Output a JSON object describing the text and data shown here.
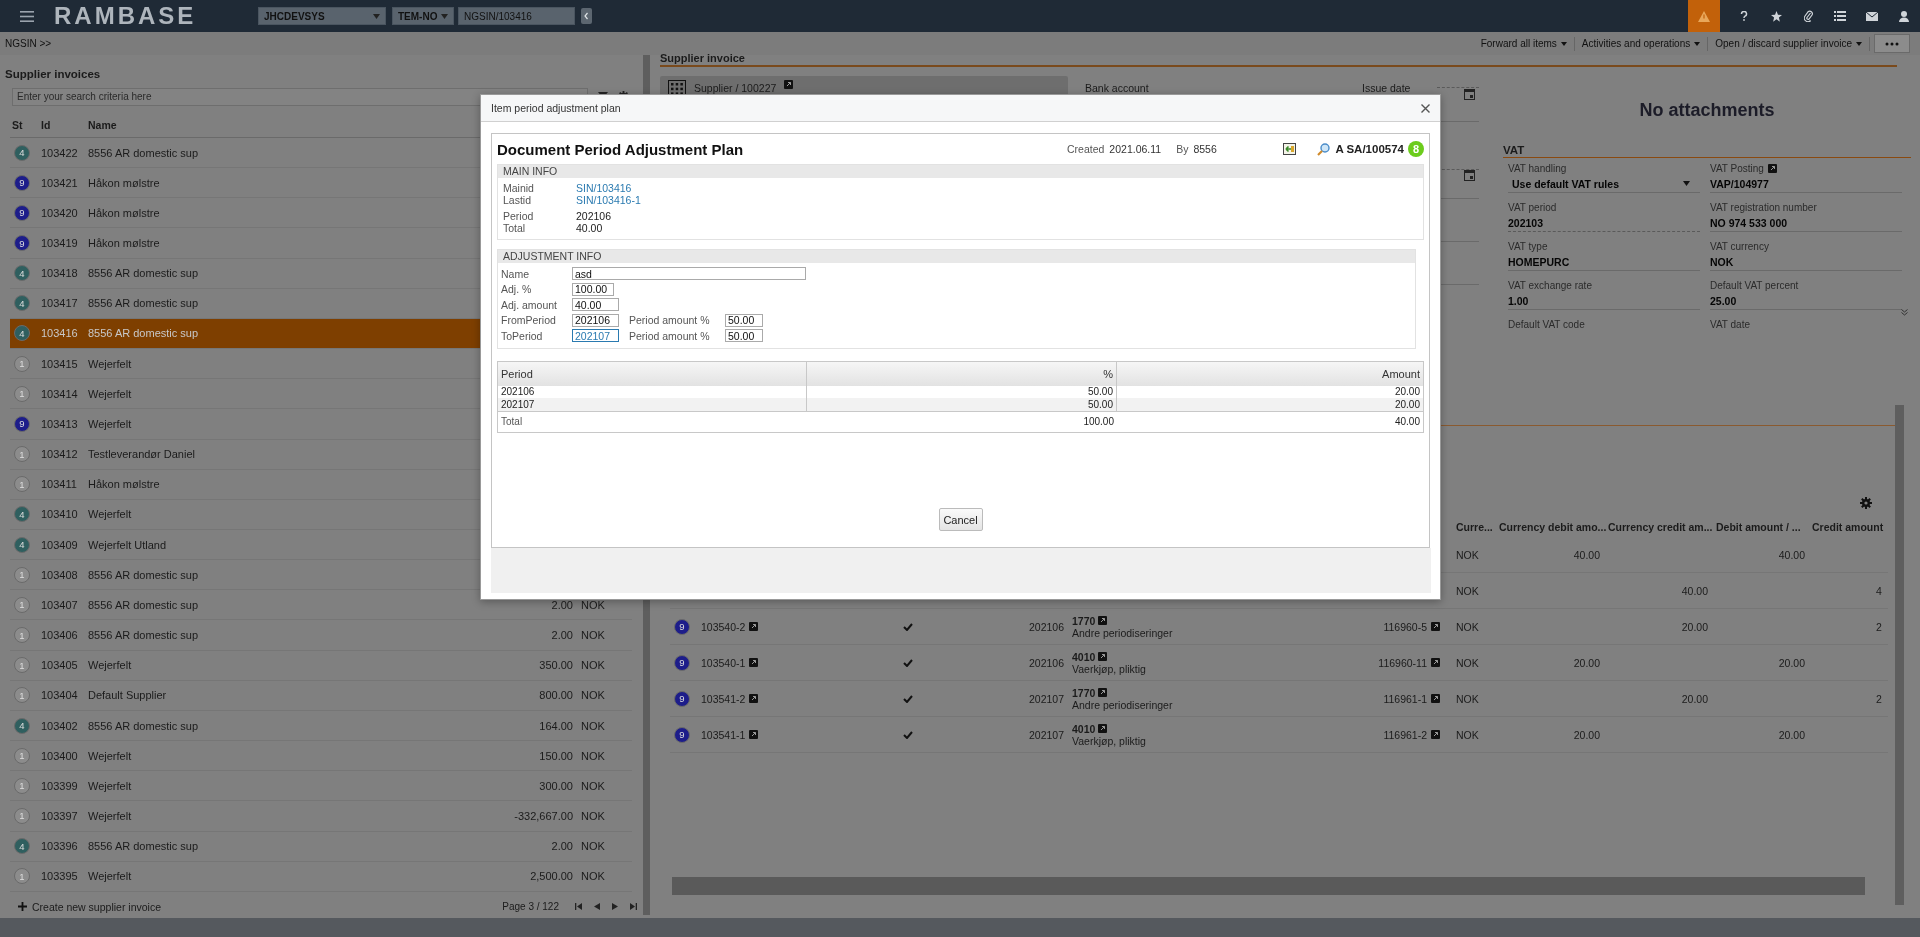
{
  "topbar": {
    "logo": "RAMBASE",
    "company": "JHCDEVSYS",
    "region": "TEM-NO",
    "document": "NGSIN/103416"
  },
  "breadcrumb": "NGSIN >>",
  "actions": [
    {
      "label": "Forward all items"
    },
    {
      "label": "Activities and operations"
    },
    {
      "label": "Open / discard supplier invoice"
    }
  ],
  "supplier_invoices": {
    "title": "Supplier invoices",
    "search_placeholder": "Enter your search criteria here",
    "columns": [
      "St",
      "Id",
      "Name"
    ],
    "rows": [
      {
        "status": "4",
        "color": "#2f5f5f",
        "id": "103422",
        "name": "8556 AR domestic sup",
        "selected": false
      },
      {
        "status": "9",
        "color": "#1d1d8a",
        "id": "103421",
        "name": "Håkon mølstre",
        "selected": false
      },
      {
        "status": "9",
        "color": "#1d1d8a",
        "id": "103420",
        "name": "Håkon mølstre",
        "selected": false
      },
      {
        "status": "9",
        "color": "#1d1d8a",
        "id": "103419",
        "name": "Håkon mølstre",
        "selected": false
      },
      {
        "status": "4",
        "color": "#2f5f5f",
        "id": "103418",
        "name": "8556 AR domestic sup",
        "selected": false
      },
      {
        "status": "4",
        "color": "#2f5f5f",
        "id": "103417",
        "name": "8556 AR domestic sup",
        "selected": false
      },
      {
        "status": "4",
        "color": "#2f5f5f",
        "id": "103416",
        "name": "8556 AR domestic sup",
        "selected": true
      },
      {
        "status": "1",
        "color": "#8c8c8c",
        "id": "103415",
        "name": "Wejerfelt",
        "selected": false
      },
      {
        "status": "1",
        "color": "#8c8c8c",
        "id": "103414",
        "name": "Wejerfelt",
        "selected": false
      },
      {
        "status": "9",
        "color": "#1d1d8a",
        "id": "103413",
        "name": "Wejerfelt",
        "selected": false
      },
      {
        "status": "1",
        "color": "#8c8c8c",
        "id": "103412",
        "name": "Testleverandør Daniel",
        "selected": false
      },
      {
        "status": "1",
        "color": "#8c8c8c",
        "id": "103411",
        "name": "Håkon mølstre",
        "selected": false
      },
      {
        "status": "4",
        "color": "#2f5f5f",
        "id": "103410",
        "name": "Wejerfelt",
        "selected": false
      },
      {
        "status": "4",
        "color": "#2f5f5f",
        "id": "103409",
        "name": "Wejerfelt Utland",
        "selected": false
      },
      {
        "status": "1",
        "color": "#8c8c8c",
        "id": "103408",
        "name": "8556 AR domestic sup",
        "selected": false
      },
      {
        "status": "1",
        "color": "#8c8c8c",
        "id": "103407",
        "name": "8556 AR domestic sup",
        "amount": "2.00",
        "currency": "NOK",
        "selected": false
      },
      {
        "status": "1",
        "color": "#8c8c8c",
        "id": "103406",
        "name": "8556 AR domestic sup",
        "amount": "2.00",
        "currency": "NOK",
        "selected": false
      },
      {
        "status": "1",
        "color": "#8c8c8c",
        "id": "103405",
        "name": "Wejerfelt",
        "amount": "350.00",
        "currency": "NOK",
        "selected": false
      },
      {
        "status": "1",
        "color": "#8c8c8c",
        "id": "103404",
        "name": "Default Supplier",
        "amount": "800.00",
        "currency": "NOK",
        "selected": false
      },
      {
        "status": "4",
        "color": "#2f5f5f",
        "id": "103402",
        "name": "8556 AR domestic sup",
        "amount": "164.00",
        "currency": "NOK",
        "selected": false
      },
      {
        "status": "1",
        "color": "#8c8c8c",
        "id": "103400",
        "name": "Wejerfelt",
        "amount": "150.00",
        "currency": "NOK",
        "selected": false
      },
      {
        "status": "1",
        "color": "#8c8c8c",
        "id": "103399",
        "name": "Wejerfelt",
        "amount": "300.00",
        "currency": "NOK",
        "selected": false
      },
      {
        "status": "1",
        "color": "#8c8c8c",
        "id": "103397",
        "name": "Wejerfelt",
        "amount": "-332,667.00",
        "currency": "NOK",
        "selected": false
      },
      {
        "status": "4",
        "color": "#2f5f5f",
        "id": "103396",
        "name": "8556 AR domestic sup",
        "amount": "2.00",
        "currency": "NOK",
        "selected": false
      },
      {
        "status": "1",
        "color": "#8c8c8c",
        "id": "103395",
        "name": "Wejerfelt",
        "amount": "2,500.00",
        "currency": "NOK",
        "selected": false
      }
    ],
    "create_label": "Create new supplier invoice",
    "page": "Page 3 / 122"
  },
  "supplier_invoice": {
    "title": "Supplier invoice",
    "supplier": "Supplier / 100227",
    "bank_account_label": "Bank account",
    "issue_date_label": "Issue date"
  },
  "attachments": "No attachments",
  "vat": {
    "title": "VAT",
    "fields": [
      {
        "label": "VAT handling",
        "value": "Use default VAT rules",
        "kind": "select"
      },
      {
        "label": "VAT Posting",
        "value": "VAP/104977",
        "kind": "link"
      },
      {
        "label": "VAT period",
        "value": "202103",
        "kind": "input"
      },
      {
        "label": "VAT registration number",
        "value": "NO 974 533 000",
        "kind": "text"
      },
      {
        "label": "VAT type",
        "value": "HOMEPURC",
        "kind": "text"
      },
      {
        "label": "VAT currency",
        "value": "NOK",
        "kind": "text"
      },
      {
        "label": "VAT exchange rate",
        "value": "1.00",
        "kind": "text"
      },
      {
        "label": "Default VAT percent",
        "value": "25.00",
        "kind": "text"
      },
      {
        "label": "Default VAT code",
        "kind": "text"
      },
      {
        "label": "VAT date",
        "kind": "text"
      }
    ]
  },
  "postings": {
    "columns": [
      "Curre...",
      "Currency debit amo...",
      "Currency credit am...",
      "Debit amount / ...",
      "Credit amount"
    ],
    "rows": [
      {
        "currency": "NOK",
        "currency_debit": "40.00",
        "debit": "40.00"
      },
      {
        "currency": "NOK",
        "currency_credit": "40.00",
        "credit": "4"
      },
      {
        "status": "9",
        "color": "#1d1d8a",
        "id": "103540-2",
        "approved": true,
        "period": "202106",
        "account": "1770",
        "account_name": "Andre periodiseringer",
        "ref": "116960-5",
        "currency": "NOK",
        "currency_credit": "20.00",
        "credit": "2"
      },
      {
        "status": "9",
        "color": "#1d1d8a",
        "id": "103540-1",
        "approved": true,
        "period": "202106",
        "account": "4010",
        "account_name": "Vaerkjøp, pliktig",
        "ref": "116960-11",
        "currency": "NOK",
        "currency_debit": "20.00",
        "debit": "20.00"
      },
      {
        "status": "9",
        "color": "#1d1d8a",
        "id": "103541-2",
        "approved": true,
        "period": "202107",
        "account": "1770",
        "account_name": "Andre periodiseringer",
        "ref": "116961-1",
        "currency": "NOK",
        "currency_credit": "20.00",
        "credit": "2"
      },
      {
        "status": "9",
        "color": "#1d1d8a",
        "id": "103541-1",
        "approved": true,
        "period": "202107",
        "account": "4010",
        "account_name": "Vaerkjøp, pliktig",
        "ref": "116961-2",
        "currency": "NOK",
        "currency_debit": "20.00",
        "debit": "20.00"
      }
    ]
  },
  "modal": {
    "title": "Item period adjustment plan",
    "heading": "Document Period Adjustment Plan",
    "created_label": "Created",
    "created": "2021.06.11",
    "by_label": "By",
    "by": "8556",
    "doc_id": "A SA/100574",
    "doc_status": "8",
    "main_info": {
      "title": "MAIN INFO",
      "rows": [
        {
          "label": "Mainid",
          "value": "SIN/103416",
          "kind": "link"
        },
        {
          "label": "Lastid",
          "value": "SIN/103416-1",
          "kind": "link"
        },
        {
          "label": "Period",
          "value": "202106",
          "kind": "text"
        },
        {
          "label": "Total",
          "value": "40.00",
          "kind": "text"
        }
      ]
    },
    "adjustment_info": {
      "title": "ADJUSTMENT INFO",
      "fields": [
        {
          "label": "Name",
          "value": "asd",
          "kind": "wide",
          "focused": false
        },
        {
          "label": "Adj. %",
          "value": "100.00",
          "kind": "short",
          "focused": false
        },
        {
          "label": "Adj. amount",
          "value": "40.00",
          "kind": "medium",
          "focused": false
        },
        {
          "label": "FromPeriod",
          "value": "202106",
          "kind": "medium",
          "focused": false,
          "extra_label": "Period amount %",
          "extra_value": "50.00"
        },
        {
          "label": "ToPeriod",
          "value": "202107",
          "kind": "medium",
          "focused": true,
          "extra_label": "Period amount %",
          "extra_value": "50.00"
        }
      ]
    },
    "plan_table": {
      "columns": [
        "Period",
        "%",
        "Amount"
      ],
      "rows": [
        [
          "202106",
          "50.00",
          "20.00"
        ],
        [
          "202107",
          "50.00",
          "20.00"
        ]
      ],
      "total": [
        "Total",
        "100.00",
        "40.00"
      ]
    },
    "cancel": "Cancel"
  }
}
